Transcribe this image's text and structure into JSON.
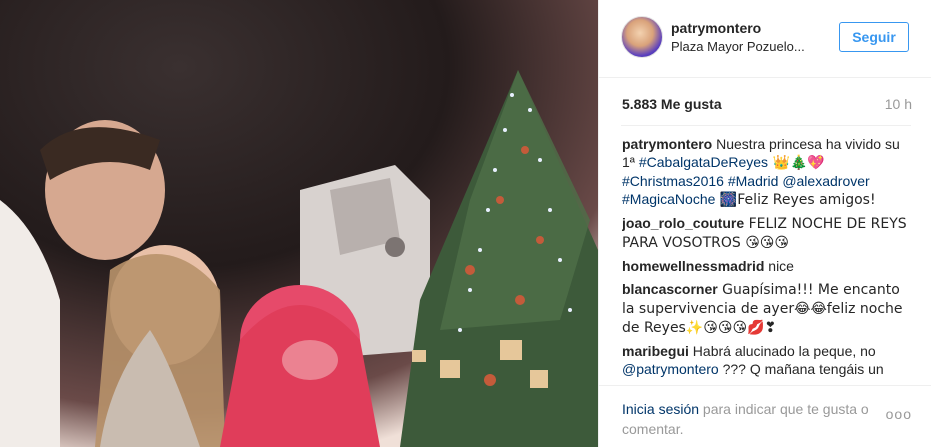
{
  "post": {
    "username": "patrymontero",
    "location": "Plaza Mayor Pozuelo...",
    "follow_label": "Seguir",
    "likes": "5.883 Me gusta",
    "time": "10 h"
  },
  "caption": {
    "user": "patrymontero",
    "text1": " Nuestra princesa ha vivido su 1ª ",
    "tag1": "#CabalgataDeReyes",
    "text2": " 👑🎄💖 ",
    "tag2": "#Christmas2016",
    "space1": " ",
    "tag3": "#Madrid",
    "space2": " ",
    "tag4": "@alexadrover",
    "space3": " ",
    "tag5": "#MagicaNoche",
    "text3": " 🎆Feliz Reyes amigos!"
  },
  "comments": [
    {
      "user": "joao_rolo_couture",
      "text": " FELIZ NOCHE DE REYS PARA VOSOTROS 😘😘😘"
    },
    {
      "user": "homewellnessmadrid",
      "text": " nice"
    },
    {
      "user": "blancascorner",
      "text": " Guapísima!!! Me encanto la supervivencia de ayer😂😂feliz noche de Reyes✨😘😘😘💋❣"
    },
    {
      "user": "maribegui",
      "text": " Habrá alucinado la peque, no ",
      "tag": "@patrymontero",
      "text2": " ??? Q mañana tengáis un"
    }
  ],
  "footer": {
    "login_link": "Inicia sesión",
    "login_text": " para indicar que te gusta o comentar.",
    "more": "ooo"
  },
  "colors": {
    "accent": "#3897f0",
    "link": "#003569",
    "muted": "#999999"
  }
}
